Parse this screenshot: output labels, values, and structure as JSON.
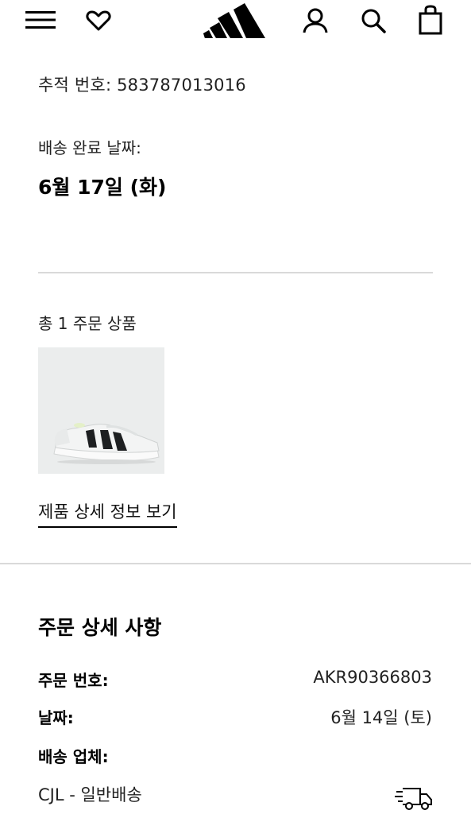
{
  "header": {
    "icons": [
      "menu-icon",
      "heart-icon",
      "adidas-logo",
      "user-icon",
      "search-icon",
      "bag-icon"
    ]
  },
  "shipment": {
    "tracking_text": "추적 번호: 583787013016",
    "delivered_label": "배송 완료 날짜:",
    "delivered_date": "6월 17일 (화)"
  },
  "items": {
    "count_text": "총 1 주문 상품",
    "product_image": "running-shoe-image",
    "detail_link": "제품 상세 정보 보기"
  },
  "order_details": {
    "title": "주문 상세 사항",
    "order_number_label": "주문 번호:",
    "order_number": "AKR90366803",
    "date_label": "날짜:",
    "date": "6월 14일 (토)",
    "carrier_label": "배송 업체:",
    "carrier": "CJL - 일반배송",
    "carrier_icon": "truck-icon"
  },
  "colors": {
    "text": "#000000",
    "divider": "#d9d9d9",
    "product_bg": "#ebeded"
  }
}
